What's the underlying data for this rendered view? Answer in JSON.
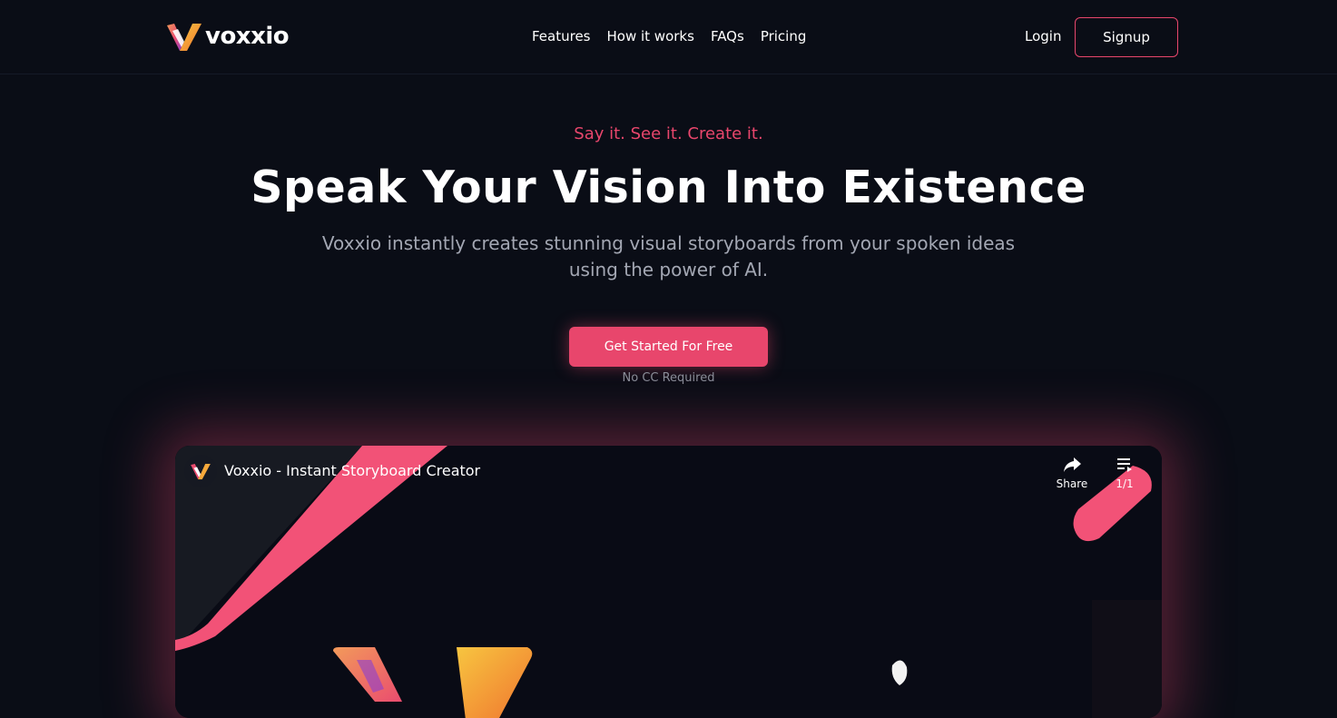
{
  "brand": {
    "name": "voxxio",
    "logo_icon": "voxxio-v-logo",
    "accent_color": "#e8466c"
  },
  "nav": {
    "items": [
      {
        "label": "Features"
      },
      {
        "label": "How it works"
      },
      {
        "label": "FAQs"
      },
      {
        "label": "Pricing"
      }
    ],
    "login_label": "Login",
    "signup_label": "Signup"
  },
  "hero": {
    "tagline": "Say it. See it. Create it.",
    "headline": "Speak Your Vision Into Existence",
    "subheadline": "Voxxio instantly creates stunning visual storyboards from your spoken ideas using the power of AI.",
    "cta_label": "Get Started For Free",
    "cta_note": "No CC Required"
  },
  "video": {
    "title": "Voxxio - Instant Storyboard Creator",
    "share_label": "Share",
    "share_icon": "share-arrow-icon",
    "playlist_icon": "playlist-icon",
    "playlist_count": "1/1"
  }
}
